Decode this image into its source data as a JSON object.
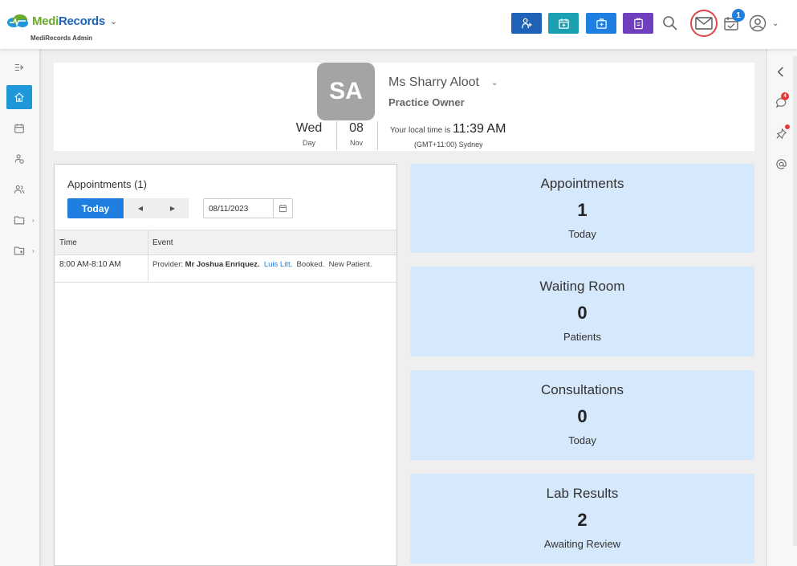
{
  "brand": {
    "name_part1": "Medi",
    "name_part2": "Records",
    "subtitle": "MediRecords Admin"
  },
  "header": {
    "calendar_badge": "1",
    "actions": [
      "add-patient-icon",
      "calendar-plus-icon",
      "medical-bag-icon",
      "clipboard-icon"
    ]
  },
  "profile": {
    "initials": "SA",
    "name": "Ms Sharry Aloot",
    "role": "Practice Owner",
    "weekday": "Wed",
    "weekday_label": "Day",
    "day_number": "08",
    "month": "Nov",
    "local_time_label": "Your local time is",
    "local_time": "11:39 AM",
    "timezone": "(GMT+11:00) Sydney"
  },
  "appointments_panel": {
    "title": "Appointments (1)",
    "today_label": "Today",
    "date_value": "08/11/2023",
    "columns": [
      "Time",
      "Event"
    ],
    "rows": [
      {
        "time": "8:00 AM-8:10 AM",
        "provider_label": "Provider:",
        "provider": "Mr Joshua Enriquez.",
        "patient": "Luis Litt",
        "status": "Booked.",
        "type": "New Patient."
      }
    ]
  },
  "stats": [
    {
      "title": "Appointments",
      "value": "1",
      "sub": "Today"
    },
    {
      "title": "Waiting Room",
      "value": "0",
      "sub": "Patients"
    },
    {
      "title": "Consultations",
      "value": "0",
      "sub": "Today"
    },
    {
      "title": "Lab Results",
      "value": "2",
      "sub": "Awaiting Review"
    }
  ],
  "rail": {
    "chat_badge": "4"
  },
  "colors": {
    "primary": "#1e7fe0",
    "teal": "#1aa0b0",
    "navy": "#1e63b8",
    "purple": "#6f3fbf",
    "card": "#d6e8fb",
    "highlight": "#e0454b"
  }
}
